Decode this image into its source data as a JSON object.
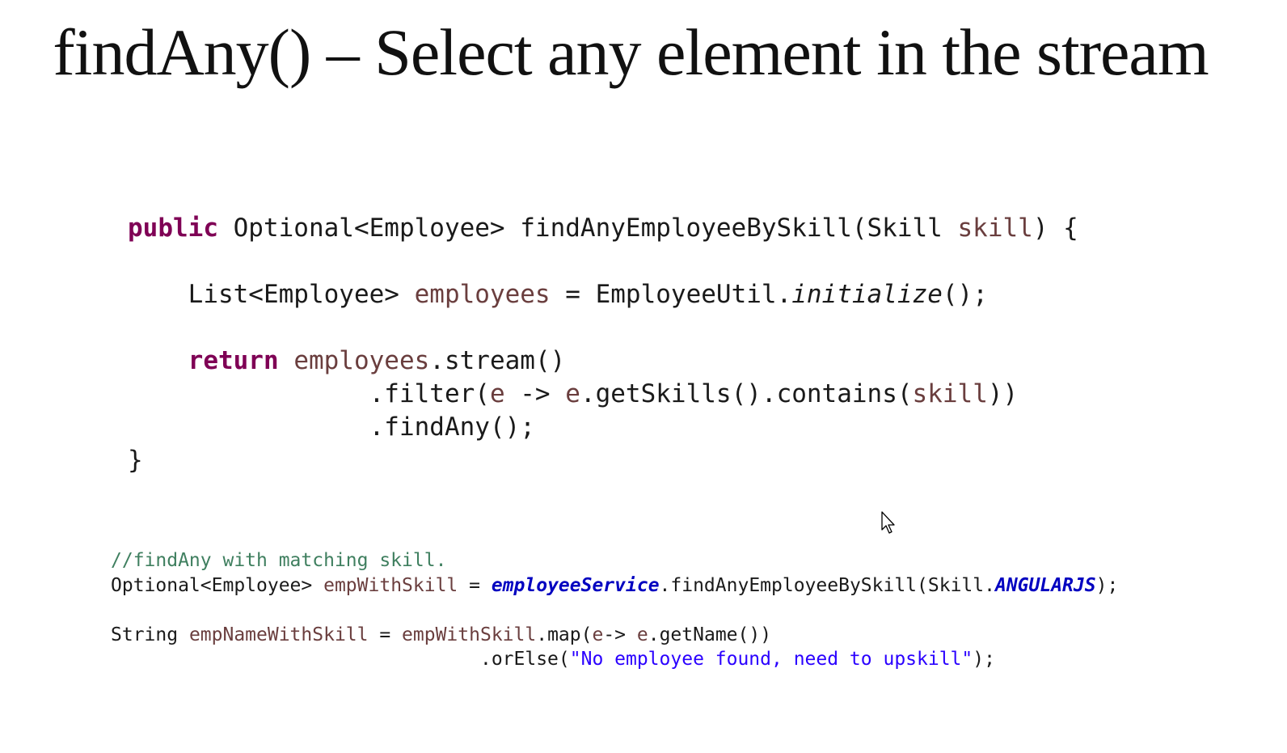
{
  "slide": {
    "title": "findAny() – Select any element in the stream"
  },
  "main_code": {
    "l1": {
      "kw": "public",
      "pre": " Optional<Employee> findAnyEmployeeBySkill(Skill ",
      "var": "skill",
      "post": ") {"
    },
    "l2": {
      "indent": "    ",
      "pre": "List<Employee> ",
      "var": "employees",
      "mid": " = EmployeeUtil.",
      "static": "initialize",
      "post": "();"
    },
    "l3": {
      "indent": "    ",
      "kw": "return",
      "sp": " ",
      "var": "employees",
      "post": ".stream()"
    },
    "l4": {
      "indent": "                ",
      "pre": ".filter(",
      "var1": "e",
      "mid1": " -> ",
      "var2": "e",
      "mid2": ".getSkills().contains(",
      "var3": "skill",
      "post": "))"
    },
    "l5": {
      "indent": "                ",
      "text": ".findAny();"
    },
    "l6": {
      "text": "}"
    }
  },
  "usage_code": {
    "comment": "//findAny with matching skill.",
    "l2": {
      "pre": "Optional<Employee> ",
      "var": "empWithSkill",
      "mid": " = ",
      "field": "employeeService",
      "mid2": ".findAnyEmployeeBySkill(Skill.",
      "const": "ANGULARJS",
      "post": ");"
    },
    "l4": {
      "pre": "String ",
      "var": "empNameWithSkill",
      "mid": " = ",
      "var2": "empWithSkill",
      "mid2": ".map(",
      "var3": "e",
      "mid3": "-> ",
      "var4": "e",
      "post": ".getName())"
    },
    "l5": {
      "indent": "                                 ",
      "pre": ".orElse(",
      "str": "\"No employee found, need to upskill\"",
      "post": ");"
    }
  }
}
